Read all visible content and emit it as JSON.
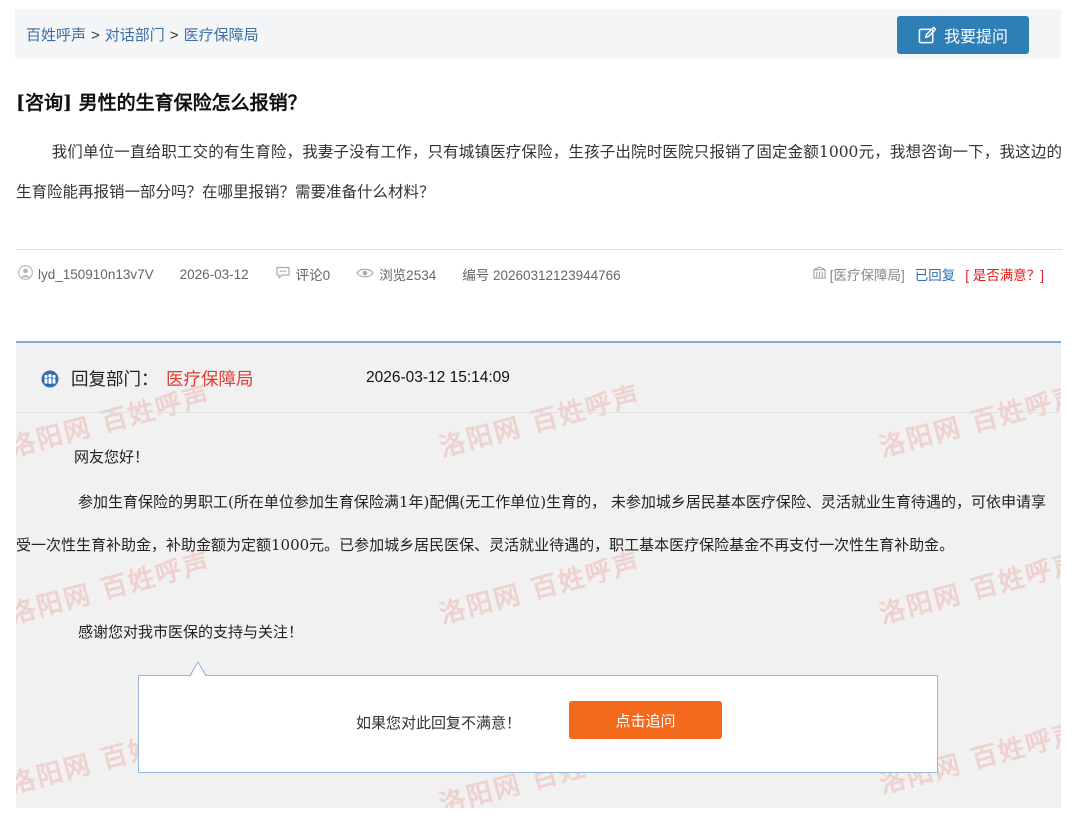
{
  "breadcrumb": [
    "百姓呼声",
    "对话部门",
    "医疗保障局"
  ],
  "breadcrumb_sep": ">",
  "ask_button": {
    "label": "我要提问",
    "icon": "edit-icon"
  },
  "question": {
    "tag": "[咨询]",
    "title": "男性的生育保险怎么报销？",
    "body": "我们单位一直给职工交的有生育险，我妻子没有工作，只有城镇医疗保险，生孩子出院时医院只报销了固定金额1000元，我想咨询一下，我这边的生育险能再报销一部分吗？在哪里报销？需要准备什么材料？"
  },
  "meta": {
    "user": "lyd_150910n13v7V",
    "date": "2026-03-12",
    "comments": "评论0",
    "views": "浏览2534",
    "number": "编号 20260312123944766",
    "dept": "[医疗保障局]",
    "replied": "已回复",
    "satisfied": "[ 是否满意？]"
  },
  "reply": {
    "label": "回复部门：",
    "dept": "医疗保障局",
    "time": "2026-03-12 15:14:09",
    "greeting": "网友您好！",
    "body": "参加生育保险的男职工(所在单位参加生育保险满1年)配偶(无工作单位)生育的， 未参加城乡居民基本医疗保险、灵活就业生育待遇的，可依申请享受一次性生育补助金，补助金额为定额1000元。已参加城乡居民医保、灵活就业待遇的，职工基本医疗保险基金不再支付一次性生育补助金。",
    "thanks": "感谢您对我市医保的支持与关注！"
  },
  "follow": {
    "text": "如果您对此回复不满意！",
    "button": "点击追问"
  },
  "watermark": {
    "text": "洛阳网 百姓呼声",
    "color": "#e1463c"
  },
  "colors": {
    "accent_blue": "#2f7fb7",
    "link_blue": "#3a6ea5",
    "reply_dept_red": "#e03c31",
    "follow_orange": "#f36a1c",
    "panel_border": "#7eaedb"
  }
}
